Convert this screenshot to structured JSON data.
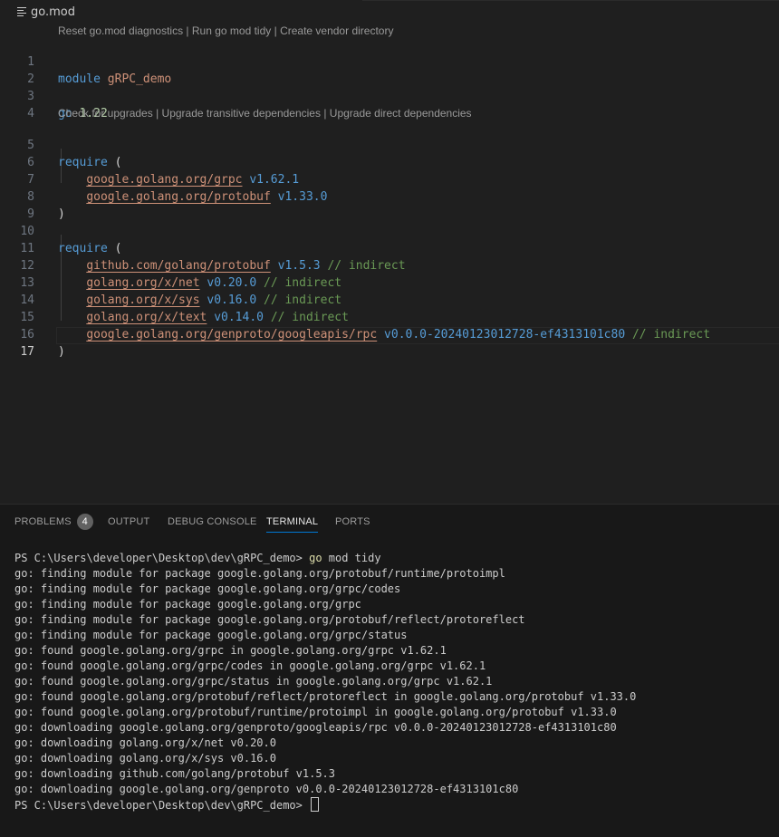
{
  "breadcrumb": {
    "icon": "list-icon",
    "file": "go.mod"
  },
  "codelens": {
    "top": [
      "Reset go.mod diagnostics",
      "Run go mod tidy",
      "Create vendor directory"
    ],
    "require": [
      "Check for upgrades",
      "Upgrade transitive dependencies",
      "Upgrade direct dependencies"
    ],
    "separator": " | "
  },
  "editor": {
    "line_numbers": [
      "1",
      "2",
      "3",
      "4",
      "5",
      "6",
      "7",
      "8",
      "9",
      "10",
      "11",
      "12",
      "13",
      "14",
      "15",
      "16",
      "17"
    ],
    "module_kw": "module",
    "module_name": "gRPC_demo",
    "go_kw": "go",
    "go_version": "1.22",
    "require_kw": "require",
    "open_paren": "(",
    "close_paren": ")",
    "direct": [
      {
        "path": "google.golang.org/grpc",
        "version": "v1.62.1"
      },
      {
        "path": "google.golang.org/protobuf",
        "version": "v1.33.0"
      }
    ],
    "indirect": [
      {
        "path": "github.com/golang/protobuf",
        "version": "v1.5.3",
        "comment": "// indirect"
      },
      {
        "path": "golang.org/x/net",
        "version": "v0.20.0",
        "comment": "// indirect"
      },
      {
        "path": "golang.org/x/sys",
        "version": "v0.16.0",
        "comment": "// indirect"
      },
      {
        "path": "golang.org/x/text",
        "version": "v0.14.0",
        "comment": "// indirect"
      },
      {
        "path": "google.golang.org/genproto/googleapis/rpc",
        "version": "v0.0.0-20240123012728-ef4313101c80",
        "comment": "// indirect"
      }
    ]
  },
  "panel": {
    "tabs": [
      {
        "label": "PROBLEMS",
        "badge": "4"
      },
      {
        "label": "OUTPUT"
      },
      {
        "label": "DEBUG CONSOLE"
      },
      {
        "label": "TERMINAL"
      },
      {
        "label": "PORTS"
      }
    ],
    "active_tab": "TERMINAL"
  },
  "terminal": {
    "prompt": "PS C:\\Users\\developer\\Desktop\\dev\\gRPC_demo> ",
    "cmd_go": "go",
    "cmd_rest": " mod tidy",
    "output": [
      "go: finding module for package google.golang.org/protobuf/runtime/protoimpl",
      "go: finding module for package google.golang.org/grpc/codes",
      "go: finding module for package google.golang.org/grpc",
      "go: finding module for package google.golang.org/protobuf/reflect/protoreflect",
      "go: finding module for package google.golang.org/grpc/status",
      "go: found google.golang.org/grpc in google.golang.org/grpc v1.62.1",
      "go: found google.golang.org/grpc/codes in google.golang.org/grpc v1.62.1",
      "go: found google.golang.org/grpc/status in google.golang.org/grpc v1.62.1",
      "go: found google.golang.org/protobuf/reflect/protoreflect in google.golang.org/protobuf v1.33.0",
      "go: found google.golang.org/protobuf/runtime/protoimpl in google.golang.org/protobuf v1.33.0",
      "go: downloading google.golang.org/genproto/googleapis/rpc v0.0.0-20240123012728-ef4313101c80",
      "go: downloading golang.org/x/net v0.20.0",
      "go: downloading golang.org/x/sys v0.16.0",
      "go: downloading github.com/golang/protobuf v1.5.3",
      "go: downloading google.golang.org/genproto v0.0.0-20240123012728-ef4313101c80"
    ]
  }
}
